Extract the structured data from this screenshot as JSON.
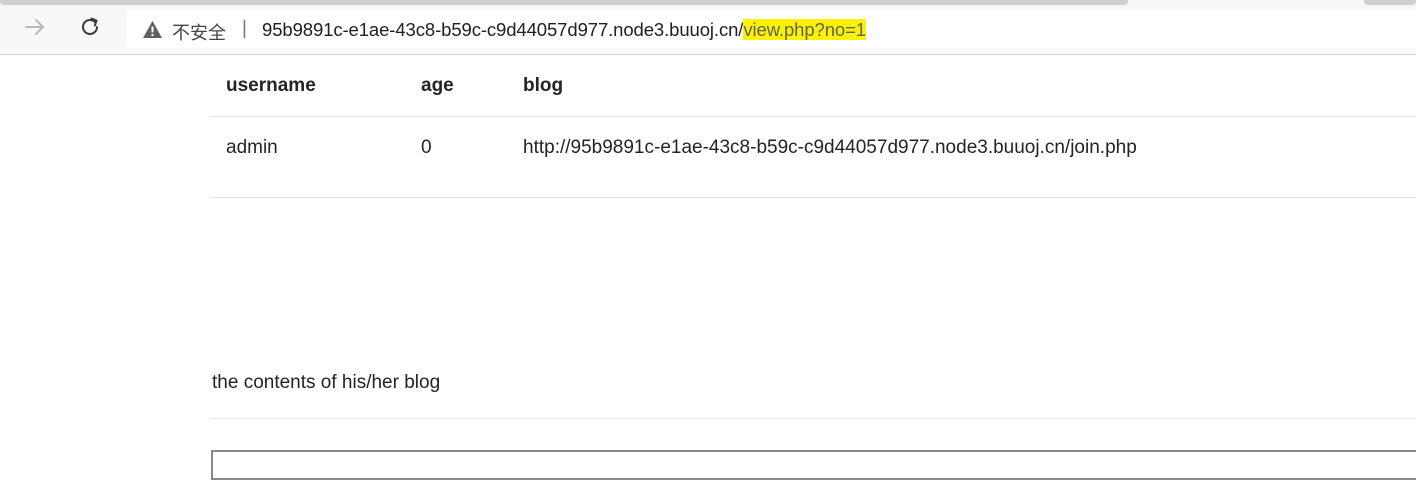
{
  "browser": {
    "security_label": "不安全",
    "separator": "|",
    "url_host": "95b9891c-e1ae-43c8-b59c-c9d44057d977.node3.buuoj.cn/",
    "url_path": "view.php?no=1",
    "highlight_color": "#fff200",
    "icons": {
      "forward": "forward-arrow-icon",
      "reload": "reload-icon",
      "security": "warning-triangle-icon"
    }
  },
  "table": {
    "headers": [
      "username",
      "age",
      "blog"
    ],
    "rows": [
      {
        "username": "admin",
        "age": "0",
        "blog": "http://95b9891c-e1ae-43c8-b59c-c9d44057d977.node3.buuoj.cn/join.php"
      }
    ]
  },
  "blog_section": {
    "heading": "the contents of his/her blog"
  }
}
